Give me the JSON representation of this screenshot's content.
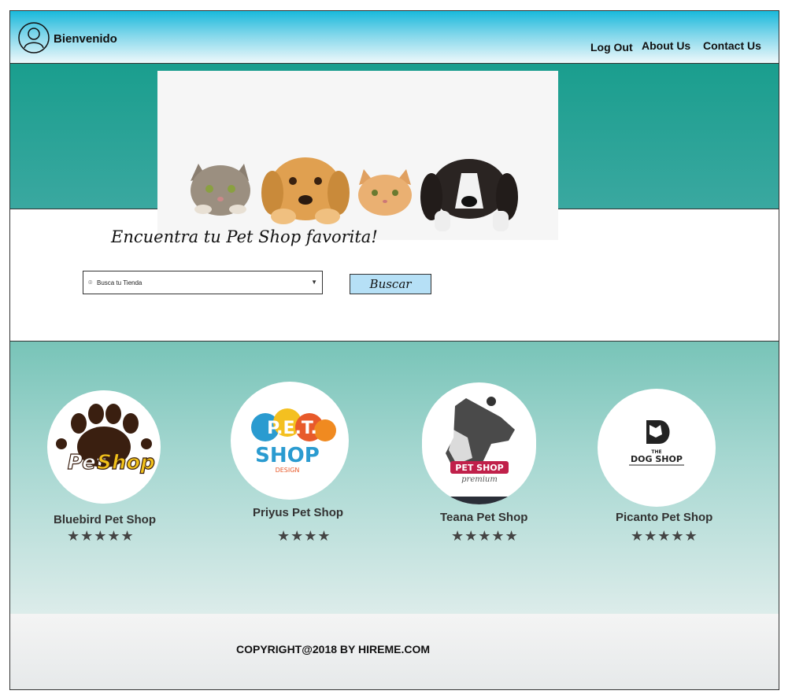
{
  "header": {
    "welcome": "Bienvenido",
    "nav": [
      "Log Out",
      "About Us",
      "Contact Us"
    ]
  },
  "hero": {
    "tagline": "Encuentra tu Pet Shop favorita!",
    "search": {
      "placeholder": "Busca tu Tienda"
    },
    "search_button": "Buscar"
  },
  "logos": {
    "bluebird": [
      "Pet",
      "Shop"
    ],
    "priyus": [
      "P.E.T.",
      "SHOP",
      "DESIGN"
    ],
    "teana": [
      "PET SHOP",
      "premium"
    ],
    "picanto": [
      "THE",
      "DOG SHOP"
    ]
  },
  "shops": [
    {
      "name": "Bluebird Pet Shop",
      "rating": 5,
      "stars": "★★★★★"
    },
    {
      "name": "Priyus Pet Shop",
      "rating": 4,
      "stars": "★★★★"
    },
    {
      "name": "Teana Pet Shop",
      "rating": 5,
      "stars": "★★★★★"
    },
    {
      "name": "Picanto Pet Shop",
      "rating": 5,
      "stars": "★★★★★"
    }
  ],
  "footer": {
    "copyright": "COPYRIGHT@2018 BY HIREME.COM"
  },
  "colors": {
    "header_top": "#19b9db",
    "hero_band": "#1a9e8e",
    "shops_top": "#78c4b8",
    "button": "#b6e0f6",
    "star": "#444444"
  }
}
